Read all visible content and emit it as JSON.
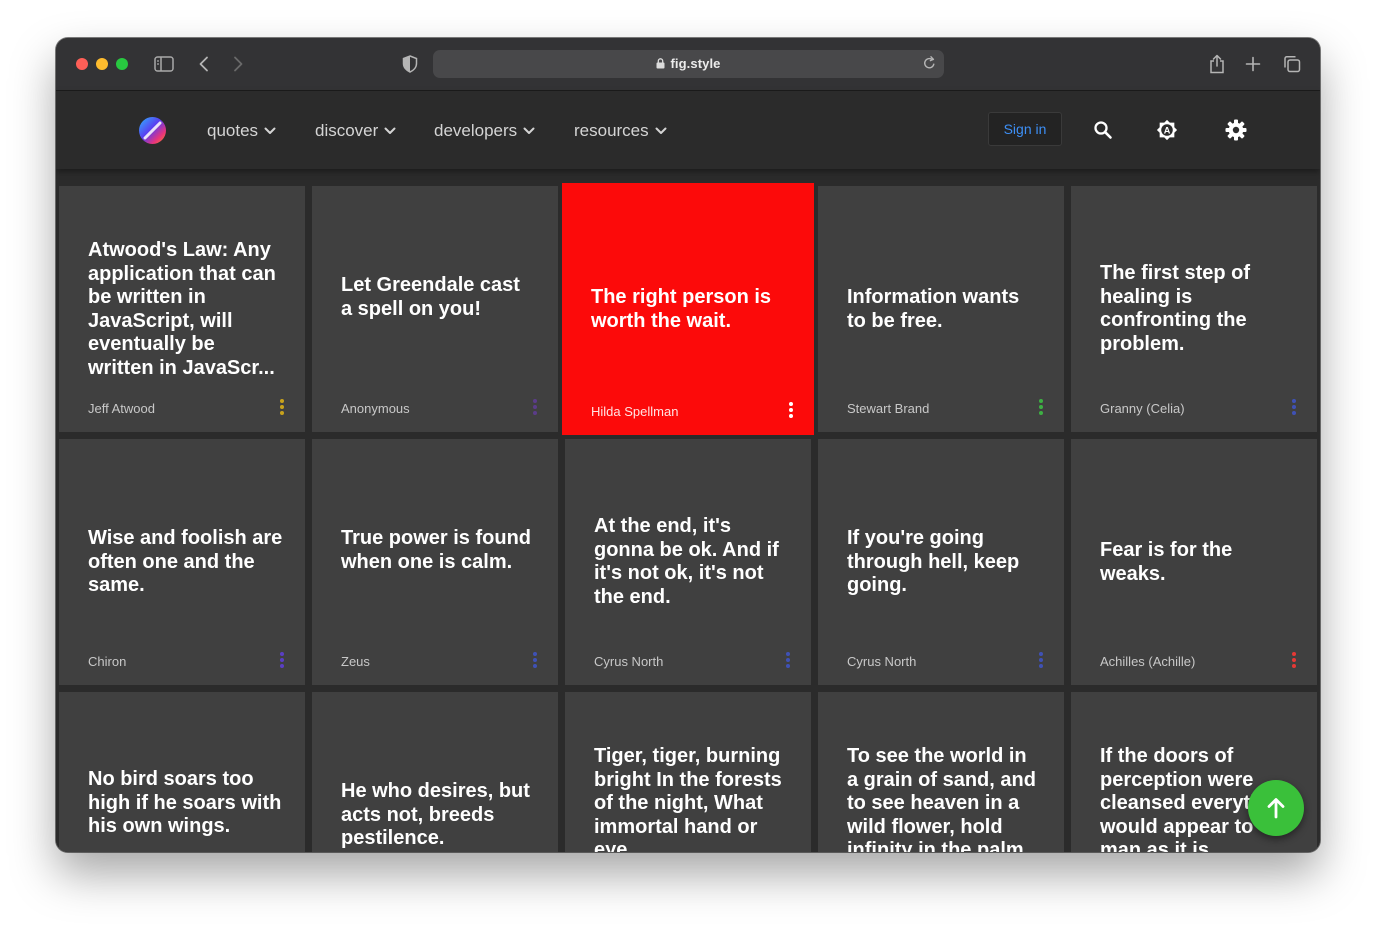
{
  "browser": {
    "url": "fig.style",
    "icons": [
      "sidebar-icon",
      "back-icon",
      "forward-icon",
      "shield-icon",
      "lock-icon",
      "reload-icon",
      "share-icon",
      "new-tab-icon",
      "tabs-overview-icon"
    ]
  },
  "nav": {
    "menus": [
      {
        "label": "quotes"
      },
      {
        "label": "discover"
      },
      {
        "label": "developers"
      },
      {
        "label": "resources"
      }
    ],
    "signin_label": "Sign in",
    "icons": [
      "logo-icon",
      "search-icon",
      "theme-auto-icon",
      "settings-gear-icon"
    ]
  },
  "cards": [
    {
      "quote": "Atwood's Law: Any application that can be written in JavaScript, will eventually be written in JavaScr...",
      "author": "Jeff Atwood",
      "accent": "#c8a21b"
    },
    {
      "quote": "Let Greendale cast a spell on you!",
      "author": "Anonymous",
      "accent": "#5b3c8a"
    },
    {
      "quote": "The right person is worth the wait.",
      "author": "Hilda Spellman",
      "accent": "#ffffff",
      "highlight": "#fc0a0a"
    },
    {
      "quote": "Information wants to be free.",
      "author": "Stewart Brand",
      "accent": "#3db043"
    },
    {
      "quote": "The first step of healing is confronting the problem.",
      "author": "Granny (Celia)",
      "accent": "#3f51b5"
    },
    {
      "quote": "Wise and foolish are often one and the same.",
      "author": "Chiron",
      "accent": "#5a3fc4"
    },
    {
      "quote": "True power is found when one is calm.",
      "author": "Zeus",
      "accent": "#3f51b5"
    },
    {
      "quote": "At the end, it's gonna be ok. And if it's not ok, it's not the end.",
      "author": "Cyrus North",
      "accent": "#3f51b5"
    },
    {
      "quote": "If you're going through hell, keep going.",
      "author": "Cyrus North",
      "accent": "#3f51b5"
    },
    {
      "quote": "Fear is for the weaks.",
      "author": "Achilles (Achille)",
      "accent": "#e53935"
    },
    {
      "quote": "No bird soars too high if he soars with his own wings.",
      "author": "",
      "accent": "#3f51b5"
    },
    {
      "quote": "He who desires, but acts not, breeds pestilence.",
      "author": "",
      "accent": "#3f51b5"
    },
    {
      "quote": "Tiger, tiger, burning bright In the forests of the night, What immortal hand or eye",
      "author": "",
      "accent": "#3f51b5"
    },
    {
      "quote": "To see the world in a grain of sand, and to see heaven in a wild flower, hold infinity in the palm",
      "author": "",
      "accent": "#3f51b5"
    },
    {
      "quote": "If the doors of perception were cleansed everything would appear to man as it is",
      "author": "",
      "accent": "#3f51b5"
    }
  ],
  "fab": {
    "icon": "arrow-up-icon",
    "color": "#3ac03a"
  }
}
